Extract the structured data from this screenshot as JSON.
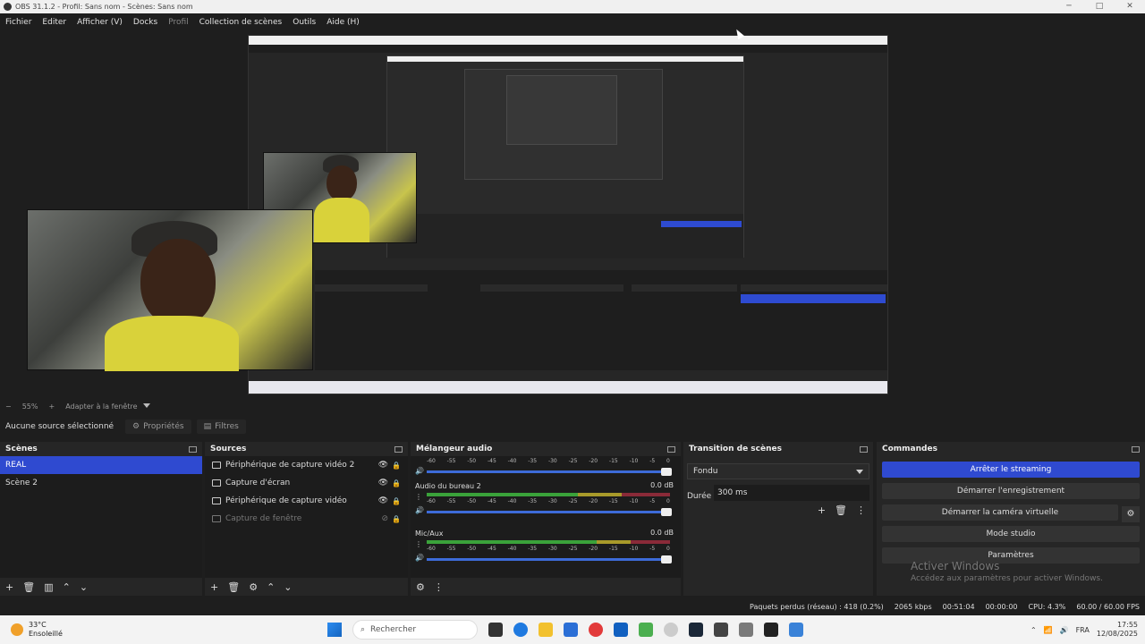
{
  "window": {
    "title": "OBS 31.1.2 - Profil: Sans nom - Scènes: Sans nom",
    "minimize": "─",
    "maximize": "□",
    "close": "✕"
  },
  "menu": [
    "Fichier",
    "Editer",
    "Afficher (V)",
    "Docks",
    "Profil",
    "Collection de scènes",
    "Outils",
    "Aide (H)"
  ],
  "zoom": {
    "minus": "−",
    "value": "55%",
    "plus": "+",
    "fit": "Adapter à la fenêtre"
  },
  "source_toolbar": {
    "no_selection": "Aucune source sélectionné",
    "properties": "Propriétés",
    "filters": "Filtres"
  },
  "scenes": {
    "title": "Scènes",
    "items": [
      "REAL",
      "Scène 2"
    ],
    "active_index": 0
  },
  "sources": {
    "title": "Sources",
    "items": [
      {
        "label": "Périphérique de capture vidéo 2",
        "icon": "camera-icon",
        "visible": true
      },
      {
        "label": "Capture d'écran",
        "icon": "monitor-icon",
        "visible": true
      },
      {
        "label": "Périphérique de capture vidéo",
        "icon": "camera-icon",
        "visible": true
      },
      {
        "label": "Capture de fenêtre",
        "icon": "window-icon",
        "visible": false
      }
    ]
  },
  "mixer": {
    "title": "Mélangeur audio",
    "channels": [
      {
        "name": "",
        "db": ""
      },
      {
        "name": "Audio du bureau 2",
        "db": "0.0 dB"
      },
      {
        "name": "Mic/Aux",
        "db": "0.0 dB"
      }
    ],
    "scale": [
      "-60",
      "-55",
      "-50",
      "-45",
      "-40",
      "-35",
      "-30",
      "-25",
      "-20",
      "-15",
      "-10",
      "-5",
      "0"
    ]
  },
  "transitions": {
    "title": "Transition de scènes",
    "selected": "Fondu",
    "duration_label": "Durée",
    "duration_value": "300 ms"
  },
  "commands": {
    "title": "Commandes",
    "buttons": [
      "Arrêter le streaming",
      "Démarrer l'enregistrement",
      "Démarrer la caméra virtuelle",
      "Mode studio",
      "Paramètres"
    ]
  },
  "watermark": {
    "line1": "Activer Windows",
    "line2": "Accédez aux paramètres pour activer Windows."
  },
  "status": {
    "dropped": "Paquets perdus (réseau) : 418 (0.2%)",
    "bitrate": "2065 kbps",
    "stream_time": "00:51:04",
    "rec_time": "00:00:00",
    "cpu": "CPU: 4.3%",
    "fps": "60.00 / 60.00 FPS"
  },
  "taskbar": {
    "temp": "33°C",
    "weather": "Ensoleillé",
    "search": "Rechercher",
    "lang": "FRA",
    "time": "17:55",
    "date": "12/08/2025"
  },
  "colors": {
    "accent": "#2f4ad0",
    "panel": "#262626",
    "bg": "#1e1e1e"
  }
}
